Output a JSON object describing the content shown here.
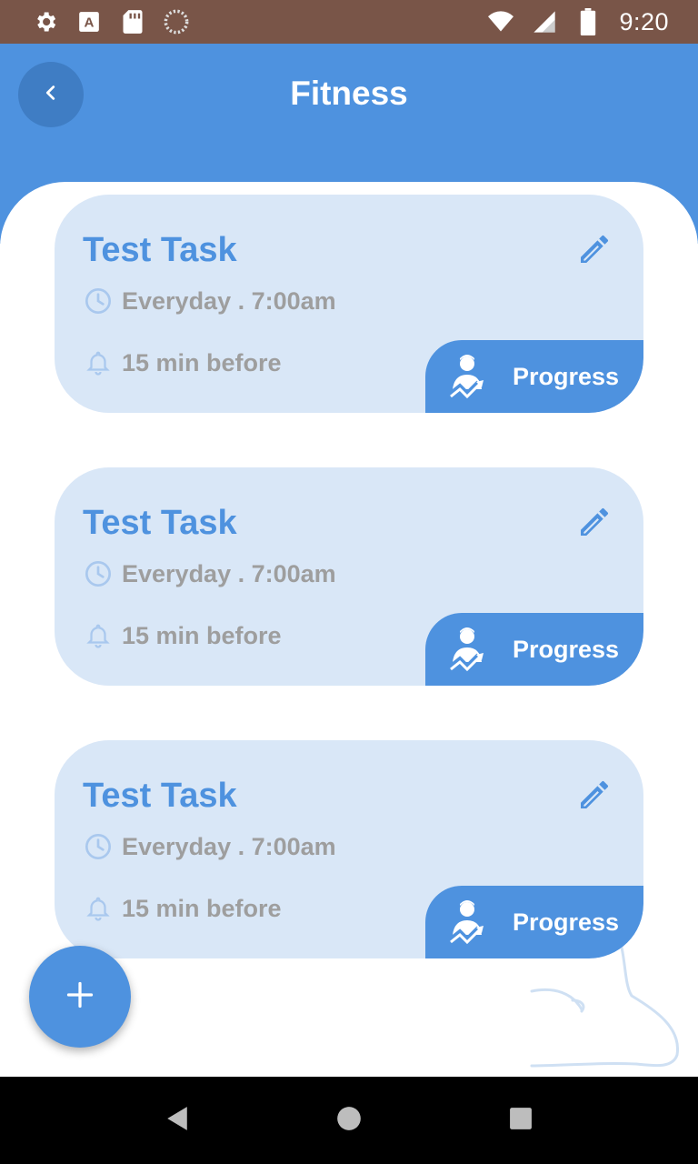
{
  "status_bar": {
    "time": "9:20",
    "icons_left": [
      "settings-icon",
      "a-icon",
      "sd-card-icon",
      "spinner-icon"
    ],
    "icons_right": [
      "wifi-icon",
      "signal-icon",
      "battery-icon"
    ]
  },
  "header": {
    "title": "Fitness",
    "back_icon": "chevron-left-icon"
  },
  "tasks": [
    {
      "title": "Test Task",
      "schedule": "Everyday . 7:00am",
      "reminder": "15 min before",
      "progress_label": "Progress"
    },
    {
      "title": "Test Task",
      "schedule": "Everyday . 7:00am",
      "reminder": "15 min before",
      "progress_label": "Progress"
    },
    {
      "title": "Test Task",
      "schedule": "Everyday . 7:00am",
      "reminder": "15 min before",
      "progress_label": "Progress"
    }
  ],
  "fab": {
    "icon": "plus-icon"
  },
  "colors": {
    "primary": "#4e92df",
    "card_bg": "#d9e7f7",
    "status_bar": "#795548",
    "muted_text": "#9e9e9e"
  },
  "nav_bar": {
    "icons": [
      "back-triangle-icon",
      "home-circle-icon",
      "recents-square-icon"
    ]
  }
}
